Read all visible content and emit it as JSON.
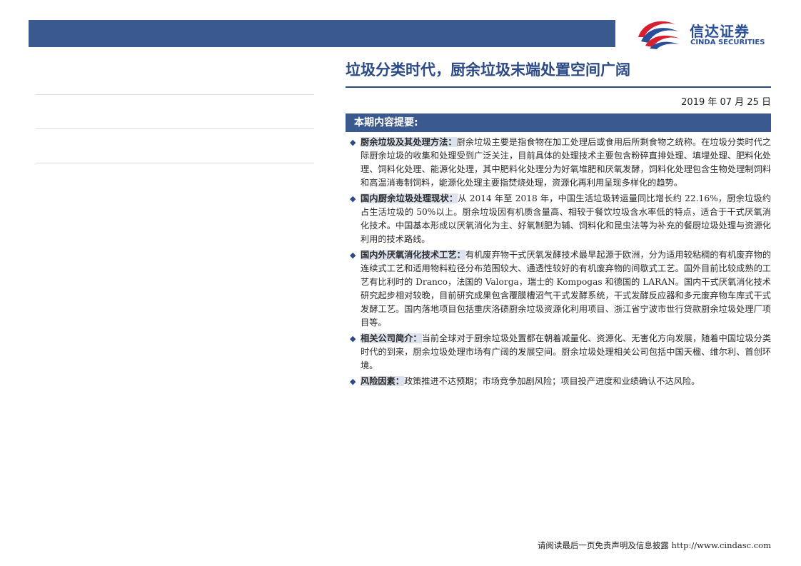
{
  "header": {
    "logo_cn": "信达证券",
    "logo_en": "CINDA SECURITIES",
    "brand_color": "#2a4e9a",
    "accent_red": "#d7202f",
    "band_color": "#3a5a8f"
  },
  "title": "垃圾分类时代，厨余垃圾末端处置空间广阔",
  "date": "2019 年 07 月 25 日",
  "section": {
    "heading": "本期内容提要:",
    "items": [
      {
        "label": "厨余垃圾及其处理方法：",
        "text": "厨余垃圾主要是指食物在加工处理后或食用后所剩食物之统称。在垃圾分类时代之际厨余垃圾的收集和处理受到广泛关注，目前具体的处理技术主要包含粉碎直排处理、填埋处理、肥料化处理、饲料化处理、能源化处理，其中肥料化处理分为好氧堆肥和厌氧发酵，饲料化处理包含生物处理制饲料和高温消毒制饲料，能源化处理主要指焚烧处理，资源化再利用呈现多样化的趋势。"
      },
      {
        "label": "国内厨余垃圾处理现状：",
        "text": "从 2014 年至 2018 年，中国生活垃圾转运量同比增长约 22.16%，厨余垃圾约占生活垃圾的 50%以上。厨余垃圾因有机质含量高、相较于餐饮垃圾含水率低的特点，适合于干式厌氧消化技术。中国基本形成以厌氧消化为主、好氧制肥为辅、饲料化和昆虫法等为补充的餐厨垃圾处理与资源化利用的技术路线。"
      },
      {
        "label": "国内外厌氧消化技术工艺：",
        "text": "有机废弃物干式厌氧发酵技术最早起源于欧洲，分为适用较粘稠的有机废弃物的连续式工艺和适用物料粒径分布范围较大、通透性较好的有机废弃物的间歇式工艺。国外目前比较成熟的工艺有比利时的 Dranco，法国的 Valorga，瑞士的 Kompogas 和德国的 LARAN。国内干式厌氧消化技术研究起步相对较晚，目前研究成果包含覆膜槽沼气干式发酵系统，干式发酵反应器和多元废弃物车库式干式发酵工艺。国内落地项目包括重庆洛碛厨余垃圾资源化利用项目、浙江省宁波市世行贷款厨余垃圾处理厂项目等。"
      },
      {
        "label": "相关公司简介：",
        "text": "当前全球对于厨余垃圾处置都在朝着减量化、资源化、无害化方向发展，随着中国垃圾分类时代的到来，厨余垃圾处理市场有广阔的发展空间。厨余垃圾处理相关公司包括中国天楹、维尔利、首创环境。"
      },
      {
        "label": "风险因素：",
        "text": "政策推进不达预期；市场竞争加剧风险；项目投产进度和业绩确认不达风险。"
      }
    ]
  },
  "footer": "请阅读最后一页免责声明及信息披露 http://www.cindasc.com"
}
